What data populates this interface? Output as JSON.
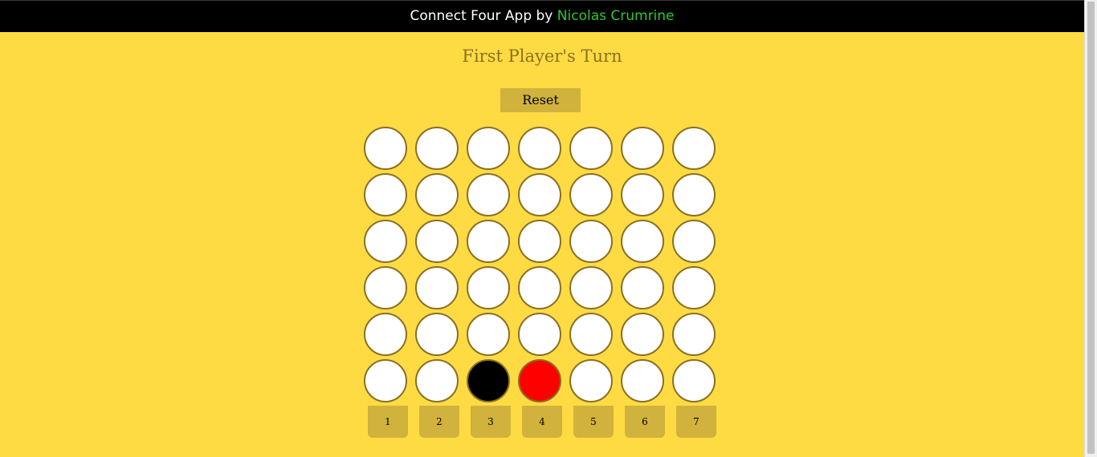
{
  "header": {
    "title_prefix": "Connect Four App by ",
    "author": "Nicolas Crumrine"
  },
  "status": {
    "turn_text": "First Player's Turn"
  },
  "controls": {
    "reset_label": "Reset"
  },
  "colors": {
    "background": "#ffdb43",
    "header_bar": "#000000",
    "author_text": "#2ec72e",
    "turn_text": "#8a7120",
    "button": "#d0b23c",
    "cell_border": "#8a7021",
    "empty_cell": "#ffffff",
    "player_one_piece": "#000000",
    "player_two_piece": "#ff0000"
  },
  "board": {
    "rows": 6,
    "columns": 7,
    "grid": [
      [
        "empty",
        "empty",
        "empty",
        "empty",
        "empty",
        "empty",
        "empty"
      ],
      [
        "empty",
        "empty",
        "empty",
        "empty",
        "empty",
        "empty",
        "empty"
      ],
      [
        "empty",
        "empty",
        "empty",
        "empty",
        "empty",
        "empty",
        "empty"
      ],
      [
        "empty",
        "empty",
        "empty",
        "empty",
        "empty",
        "empty",
        "empty"
      ],
      [
        "empty",
        "empty",
        "empty",
        "empty",
        "empty",
        "empty",
        "empty"
      ],
      [
        "empty",
        "empty",
        "black",
        "red",
        "empty",
        "empty",
        "empty"
      ]
    ],
    "column_labels": [
      "1",
      "2",
      "3",
      "4",
      "5",
      "6",
      "7"
    ]
  }
}
